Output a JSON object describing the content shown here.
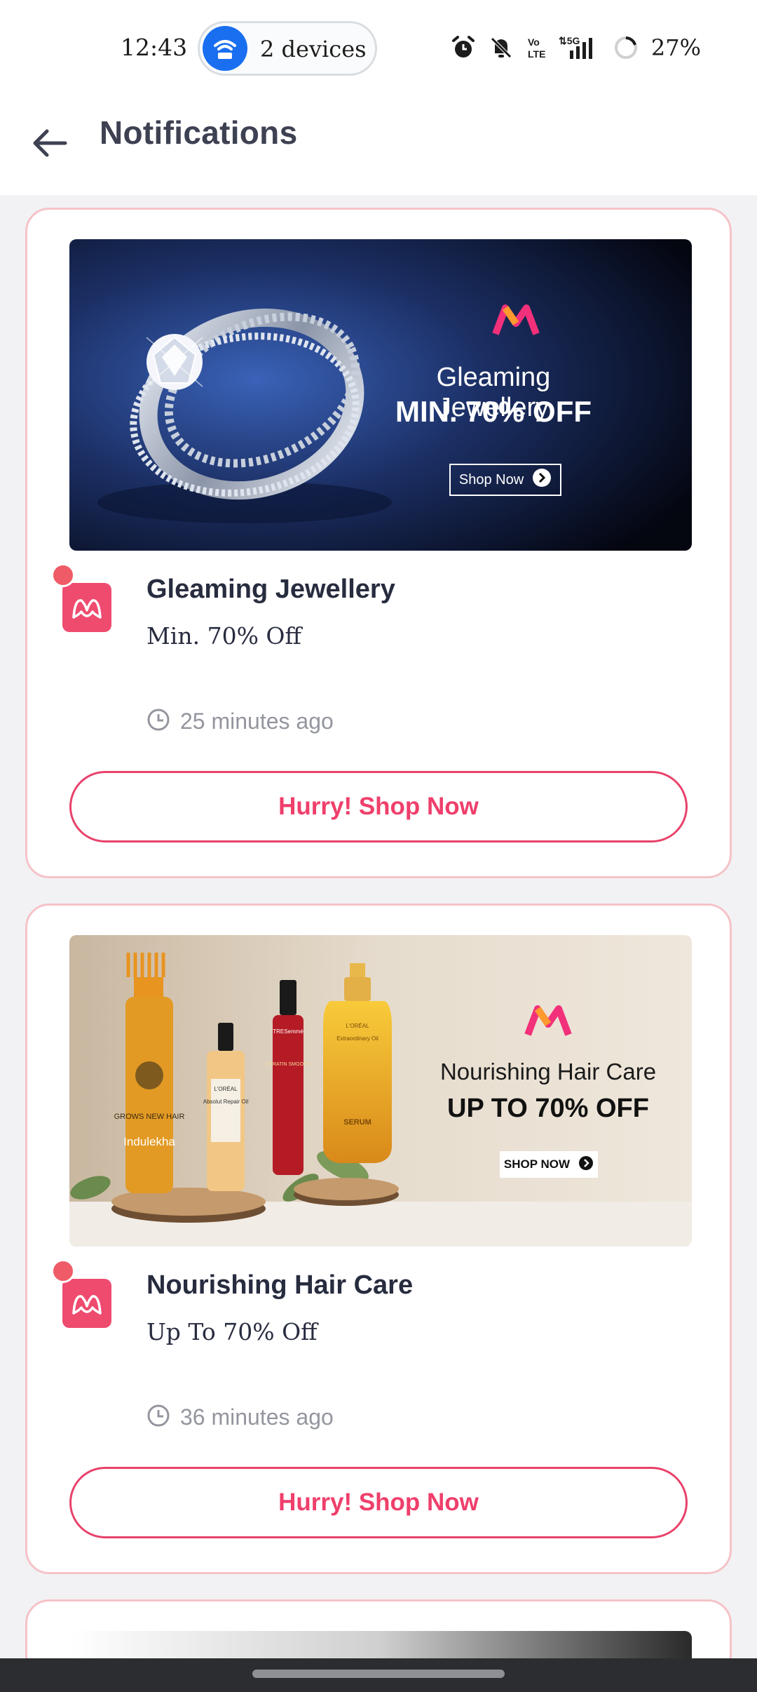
{
  "status_bar": {
    "time": "12:43",
    "hotspot_label": "2 devices",
    "battery": "27%",
    "icons": [
      "alarm-icon",
      "bell-off-icon",
      "volte-icon",
      "5g-signal-icon",
      "battery-ring-icon"
    ]
  },
  "header": {
    "title": "Notifications",
    "back_icon": "arrow-left-icon"
  },
  "notifications": [
    {
      "banner": {
        "headline": "Gleaming Jewellery",
        "offer": "MIN. 70% OFF",
        "cta": "Shop Now"
      },
      "title": "Gleaming Jewellery",
      "subtitle": "Min. 70% Off",
      "time": "25 minutes ago",
      "button": "Hurry! Shop Now"
    },
    {
      "banner": {
        "headline": "Nourishing Hair Care",
        "offer": "UP TO 70% OFF",
        "cta": "SHOP NOW",
        "product_labels": [
          "GROWS NEW HAIR",
          "Indulekha",
          "L'ORÉAL",
          "Absolut Repair Oil",
          "TRESemmé",
          "KERATIN SMOOTH",
          "L'ORÉAL",
          "Extraordinary Oil",
          "SERUM"
        ]
      },
      "title": "Nourishing Hair Care",
      "subtitle": "Up To 70% Off",
      "time": "36 minutes ago",
      "button": "Hurry! Shop Now"
    }
  ],
  "colors": {
    "accent": "#ef3f6b",
    "card_border": "#f5c3c8",
    "unread_dot": "#ef5b66",
    "background": "#f2f2f4"
  }
}
